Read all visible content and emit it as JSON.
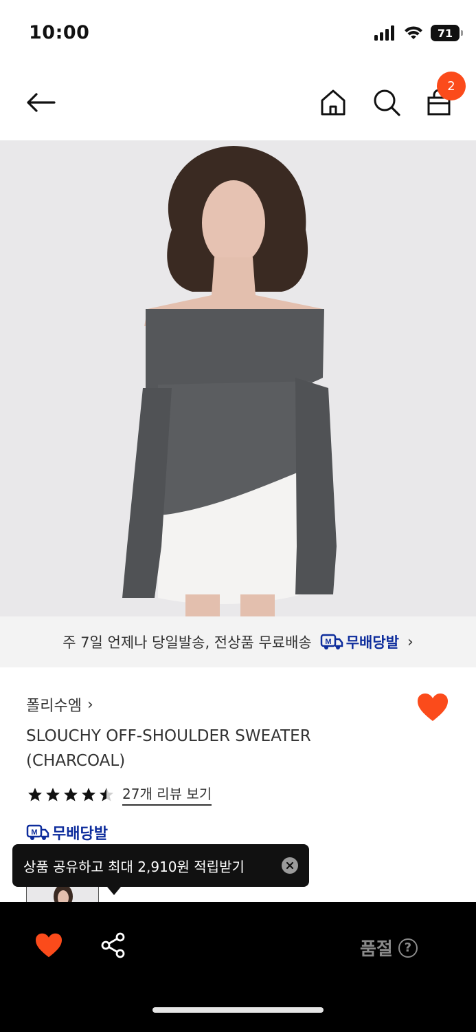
{
  "status_bar": {
    "time": "10:00",
    "battery": "71"
  },
  "header": {
    "cart_count": "2"
  },
  "delivery_banner": {
    "text": "주 7일 언제나 당일발송, 전상품 무료배송",
    "badge": "무배당발",
    "badge_icon_letter": "M"
  },
  "product": {
    "brand": "폴리수엠",
    "title": "SLOUCHY OFF-SHOULDER SWEATER (CHARCOAL)",
    "rating": 4.5,
    "review_link": "27개 리뷰 보기",
    "delivery_badge": "무배당발"
  },
  "tooltip": {
    "text": "상품 공유하고 최대 2,910원 적립받기"
  },
  "bottom_bar": {
    "status": "품절",
    "help_symbol": "?"
  },
  "colors": {
    "accent": "#fb4b1b",
    "delivery_blue": "#0d2c9c",
    "bottom_bar_bg": "#000000"
  },
  "icons": [
    "back-arrow-icon",
    "home-icon",
    "search-icon",
    "shopping-bag-icon",
    "heart-icon",
    "share-icon",
    "close-icon",
    "help-icon"
  ]
}
